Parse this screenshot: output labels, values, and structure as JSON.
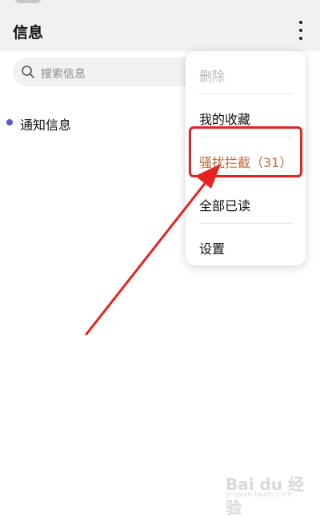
{
  "header": {
    "title": "信息"
  },
  "search": {
    "placeholder": "搜索信息"
  },
  "list": {
    "items": [
      {
        "label": "通知信息"
      }
    ]
  },
  "menu": {
    "items": [
      {
        "label": "删除"
      },
      {
        "label": "我的收藏"
      },
      {
        "label": "骚扰拦截（31）"
      },
      {
        "label": "全部已读"
      },
      {
        "label": "设置"
      }
    ]
  },
  "watermark": {
    "text": "Bai du 经验",
    "sub": "jingyan.baidu.com"
  },
  "colors": {
    "accent": "#c26a3c",
    "annotation": "#e62222",
    "dot": "#5a5acb"
  }
}
